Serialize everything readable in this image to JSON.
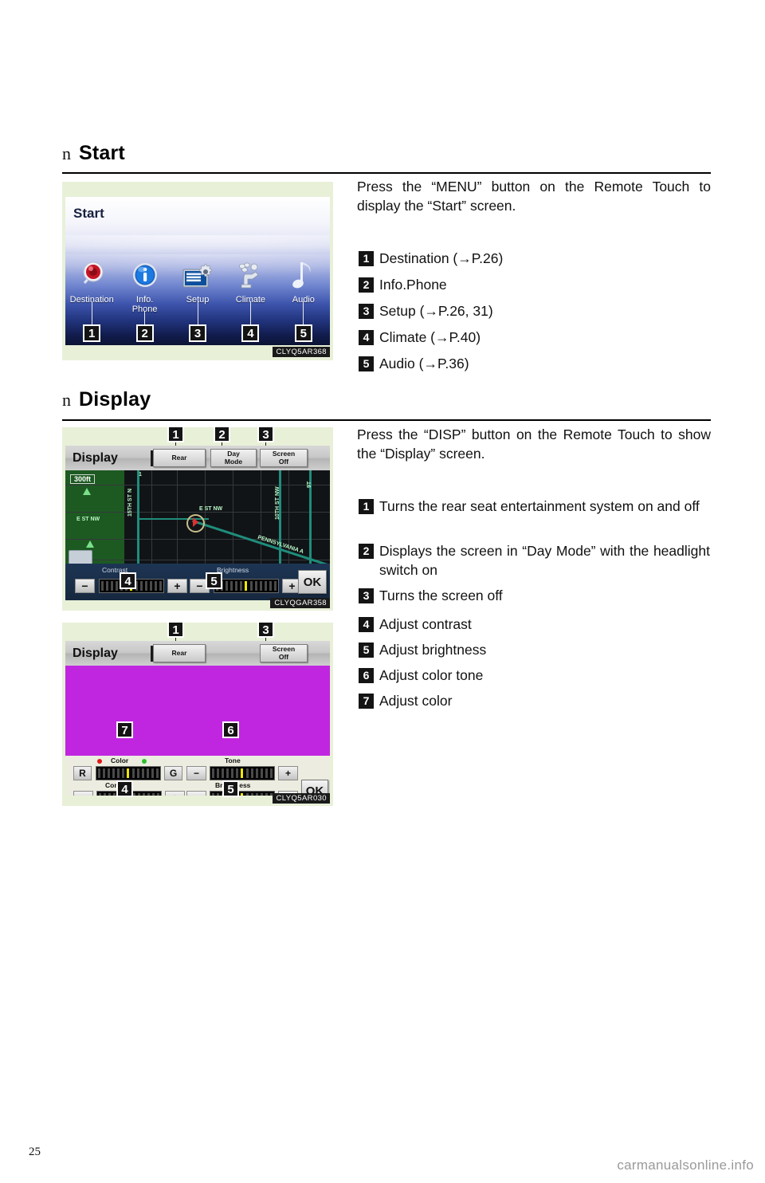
{
  "page": {
    "number": "25",
    "watermark": "carmanualsonline.info"
  },
  "sections": [
    {
      "bullet": "n",
      "title": "Start",
      "intro": "Press the “MENU” button on the Remote Touch to display the “Start” screen.",
      "figure_code": "CLYQ5AR368",
      "items": [
        {
          "num": "1",
          "text": "Destination (→P.26)"
        },
        {
          "num": "2",
          "text": "Info.Phone"
        },
        {
          "num": "3",
          "text": "Setup (→P.26, 31)"
        },
        {
          "num": "4",
          "text": "Climate (→P.40)"
        },
        {
          "num": "5",
          "text": "Audio (→P.36)"
        }
      ]
    },
    {
      "bullet": "n",
      "title": "Display",
      "intro": "Press the “DISP” button on the Remote Touch to show the “Display” screen.",
      "figure_codes": [
        "CLYQGAR358",
        "CLYQ5AR030"
      ],
      "items": [
        {
          "num": "1",
          "text": "Turns the rear seat entertainment system on and off"
        },
        {
          "num": "2",
          "text": "Displays the screen in “Day Mode” with the headlight switch on"
        },
        {
          "num": "3",
          "text": "Turns the screen off"
        },
        {
          "num": "4",
          "text": "Adjust contrast"
        },
        {
          "num": "5",
          "text": "Adjust brightness"
        },
        {
          "num": "6",
          "text": "Adjust color tone"
        },
        {
          "num": "7",
          "text": "Adjust color"
        }
      ]
    }
  ],
  "start_screen": {
    "title": "Start",
    "icons": [
      {
        "label": "Destination",
        "icon": "destination-pin-icon",
        "callout": "1"
      },
      {
        "label": "Info.\nPhone",
        "label_line1": "Info.",
        "label_line2": "Phone",
        "icon": "info-circle-icon",
        "callout": "2"
      },
      {
        "label": "Setup",
        "icon": "setup-gear-icon",
        "callout": "3"
      },
      {
        "label": "Climate",
        "icon": "climate-seat-icon",
        "callout": "4"
      },
      {
        "label": "Audio",
        "icon": "audio-note-icon",
        "callout": "5"
      }
    ]
  },
  "nav_display_screen": {
    "title": "Display",
    "buttons": [
      {
        "label_line1": "Rear",
        "label_line2": "",
        "callout": "1"
      },
      {
        "label_line1": "Day",
        "label_line2": "Mode",
        "callout": "2"
      },
      {
        "label_line1": "Screen",
        "label_line2": "Off",
        "callout": "3"
      }
    ],
    "map": {
      "scale": "300ft",
      "labels": [
        "15TH ST N",
        "E ST NW",
        "E ST NW",
        "10TH ST NW",
        "9T",
        "PENNSYLVANIA A",
        "1"
      ]
    },
    "controls": [
      {
        "label": "Contrast",
        "minus": "−",
        "plus": "+",
        "callout": "4"
      },
      {
        "label": "Brightness",
        "minus": "−",
        "plus": "+",
        "callout": "5"
      }
    ],
    "ok_label": "OK",
    "code": "CLYQGAR358"
  },
  "color_display_screen": {
    "title": "Display",
    "buttons": [
      {
        "label_line1": "Rear",
        "label_line2": "",
        "callout": "1"
      },
      {
        "label_line1": "Screen",
        "label_line2": "Off",
        "callout": "3"
      }
    ],
    "preview_color": "#c026e0",
    "controls": [
      {
        "label": "Color",
        "left": "R",
        "right": "G",
        "callout": "7",
        "dot_left": "#e01818",
        "dot_right": "#2cc02c"
      },
      {
        "label": "Tone",
        "left": "−",
        "right": "+",
        "callout": "6"
      },
      {
        "label": "Contrast",
        "left": "−",
        "right": "+",
        "callout": "4"
      },
      {
        "label": "Brightness",
        "left": "−",
        "right": "+",
        "callout": "5"
      }
    ],
    "ok_label": "OK",
    "code": "CLYQ5AR030"
  }
}
